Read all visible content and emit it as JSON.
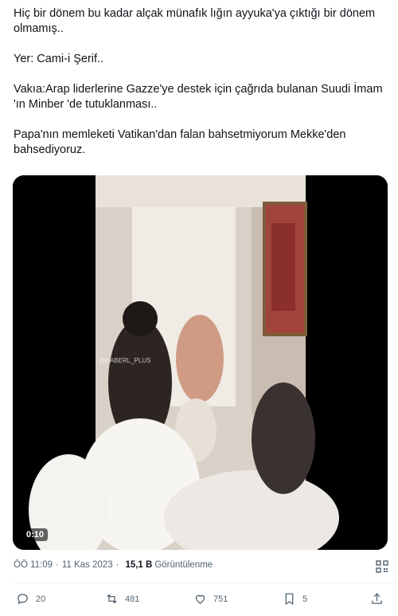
{
  "tweet": {
    "lines": [
      "Hiç bir dönem bu kadar alçak münafık lığın ayyuka'ya çıktığı bir dönem olmamış..",
      "Yer: Cami-i Şerif..",
      "Vakıa:Arap liderlerine Gazze'ye destek için çağrıda bulanan Suudi İmam 'ın Minber 'de tutuklanması..",
      "Papa'nın memleketi Vatikan'dan falan bahsetmiyorum Mekke'den bahsediyoruz."
    ]
  },
  "media": {
    "duration": "0:10",
    "watermark": "@HABERL_PLUS",
    "frame_colors": {
      "wall": "#d8cfc6",
      "bright": "#f2ede6",
      "letterbox": "#000000"
    }
  },
  "meta": {
    "time": "ÖÖ 11:09",
    "date": "11 Kas 2023",
    "views_count": "15,1 B",
    "views_label": "Görüntülenme"
  },
  "actions": {
    "replies": "20",
    "retweets": "481",
    "likes": "751",
    "bookmarks": "5"
  },
  "icons": {
    "reply": "reply-icon",
    "retweet": "retweet-icon",
    "like": "heart-icon",
    "bookmark": "bookmark-icon",
    "share": "share-icon",
    "qr": "qr-code-icon"
  }
}
